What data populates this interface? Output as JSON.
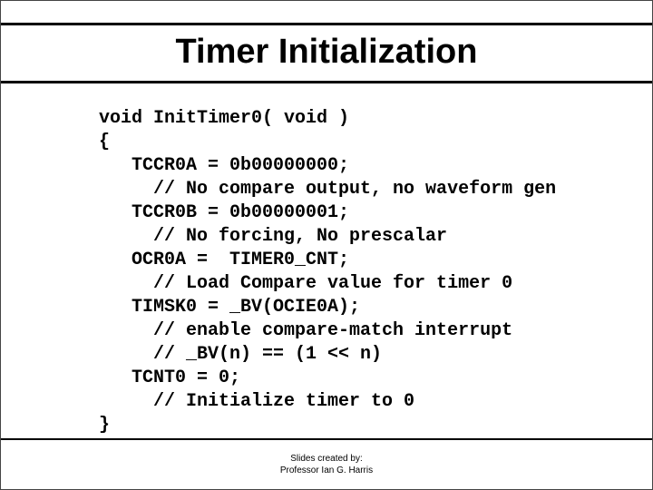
{
  "title": "Timer Initialization",
  "code": "void InitTimer0( void )\n{\n   TCCR0A = 0b00000000;\n     // No compare output, no waveform gen\n   TCCR0B = 0b00000001;\n     // No forcing, No prescalar\n   OCR0A =  TIMER0_CNT;\n     // Load Compare value for timer 0\n   TIMSK0 = _BV(OCIE0A);\n     // enable compare-match interrupt\n     // _BV(n) == (1 << n)\n   TCNT0 = 0;\n     // Initialize timer to 0\n}",
  "footer_line1": "Slides created by:",
  "footer_line2": "Professor Ian G. Harris"
}
